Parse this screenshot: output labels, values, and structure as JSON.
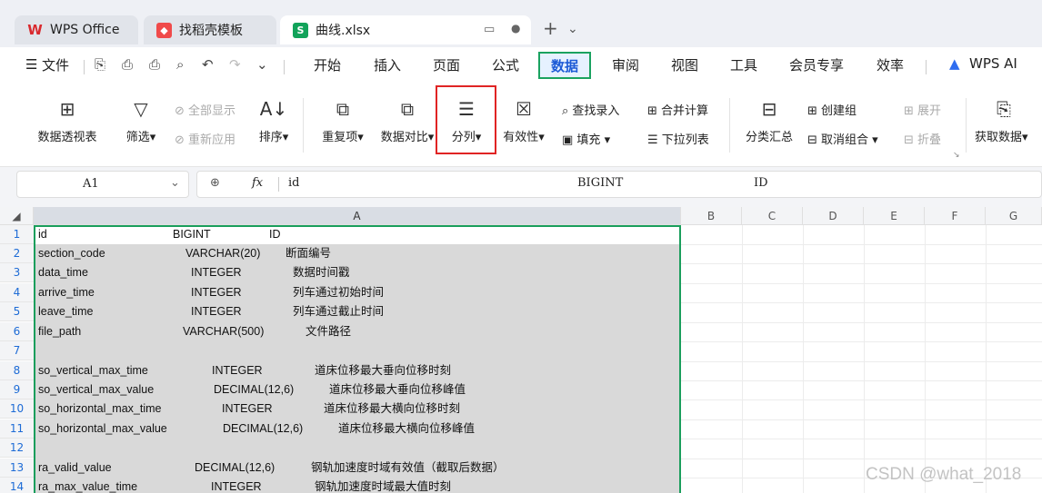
{
  "tabs": [
    {
      "label": "WPS Office",
      "icon": "wps-logo-icon"
    },
    {
      "label": "找稻壳模板",
      "icon": "docer-icon"
    },
    {
      "label": "曲线.xlsx",
      "icon": "sheet-s-icon",
      "icon_letter": "S"
    }
  ],
  "menu": {
    "file_label": "文件",
    "items": [
      "开始",
      "插入",
      "页面",
      "公式",
      "数据",
      "审阅",
      "视图",
      "工具",
      "会员专享",
      "效率"
    ],
    "active": "数据",
    "wps_ai": "WPS AI"
  },
  "ribbon": {
    "pivot": "数据透视表",
    "filter": "筛选",
    "show_all": "全部显示",
    "reapply": "重新应用",
    "sort": "排序",
    "duplicates": "重复项",
    "compare": "数据对比",
    "split": "分列",
    "validity": "有效性",
    "find_enter": "查找录入",
    "fill": "填充",
    "consolidate": "合并计算",
    "dropdown": "下拉列表",
    "subtotal": "分类汇总",
    "create_group": "创建组",
    "ungroup": "取消组合",
    "expand": "展开",
    "collapse": "折叠",
    "get_data": "获取数据"
  },
  "formula_bar": {
    "cell_ref": "A1",
    "fx": "fx",
    "content": [
      "id",
      "BIGINT",
      "ID"
    ]
  },
  "columns": [
    "A",
    "B",
    "C",
    "D",
    "E",
    "F",
    "G"
  ],
  "rows": [
    {
      "n": "1",
      "name": "id",
      "type": "BIGINT",
      "desc": "ID"
    },
    {
      "n": "2",
      "name": "section_code",
      "type": "VARCHAR(20)",
      "desc": "断面编号"
    },
    {
      "n": "3",
      "name": "data_time",
      "type": "INTEGER",
      "desc": "数据时间戳"
    },
    {
      "n": "4",
      "name": "arrive_time",
      "type": "INTEGER",
      "desc": "列车通过初始时间"
    },
    {
      "n": "5",
      "name": "leave_time",
      "type": "INTEGER",
      "desc": "列车通过截止时间"
    },
    {
      "n": "6",
      "name": "file_path",
      "type": "VARCHAR(500)",
      "desc": "文件路径"
    },
    {
      "n": "7",
      "name": "",
      "type": "",
      "desc": ""
    },
    {
      "n": "8",
      "name": "so_vertical_max_time",
      "type": "INTEGER",
      "desc": "道床位移最大垂向位移时刻"
    },
    {
      "n": "9",
      "name": "so_vertical_max_value",
      "type": "DECIMAL(12,6)",
      "desc": "道床位移最大垂向位移峰值"
    },
    {
      "n": "10",
      "name": "so_horizontal_max_time",
      "type": "INTEGER",
      "desc": "道床位移最大横向位移时刻"
    },
    {
      "n": "11",
      "name": "so_horizontal_max_value",
      "type": "DECIMAL(12,6)",
      "desc": "道床位移最大横向位移峰值"
    },
    {
      "n": "12",
      "name": "",
      "type": "",
      "desc": ""
    },
    {
      "n": "13",
      "name": "ra_valid_value",
      "type": "DECIMAL(12,6)",
      "desc": "钢轨加速度时域有效值（截取后数据）"
    },
    {
      "n": "14",
      "name": "ra_max_value_time",
      "type": "INTEGER",
      "desc": "钢轨加速度时域最大值时刻"
    }
  ],
  "watermark": "CSDN @what_2018",
  "colors": {
    "accent_green": "#1a9e5c",
    "active_blue": "#1d5bd6",
    "highlight_red": "#e02424"
  }
}
